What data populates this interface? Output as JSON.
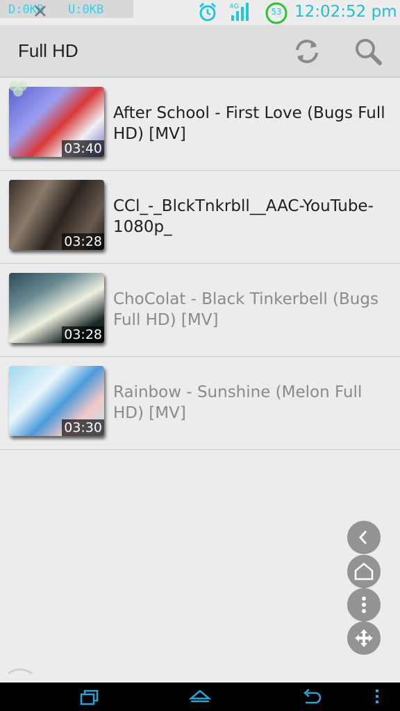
{
  "status_bar": {
    "download_speed": "D:0KB",
    "upload_speed": "U:0KB",
    "battery_level": "53",
    "time": "12:02:52 pm",
    "icons": [
      "close-icon",
      "alarm-icon",
      "signal-icon",
      "battery-icon"
    ]
  },
  "action_bar": {
    "title": "Full HD",
    "icons": [
      "refresh-icon",
      "search-icon"
    ]
  },
  "videos": [
    {
      "title": "After School - First Love (Bugs Full HD) [MV]",
      "duration": "03:40",
      "dimmed": false
    },
    {
      "title": "CCl_-_BlckTnkrbll__AAC-YouTube-1080p_",
      "duration": "03:28",
      "dimmed": false
    },
    {
      "title": "ChoColat - Black Tinkerbell (Bugs Full HD) [MV]",
      "duration": "03:28",
      "dimmed": true
    },
    {
      "title": "Rainbow - Sunshine (Melon Full HD) [MV]",
      "duration": "03:30",
      "dimmed": true
    }
  ],
  "floating_controls": [
    "back-icon",
    "home-icon",
    "more-icon",
    "move-icon"
  ],
  "nav_bar": [
    "recent-apps-icon",
    "home-icon",
    "back-icon",
    "menu-icon"
  ],
  "colors": {
    "accent_cyan": "#22c0cc",
    "battery_green": "#2fc12f",
    "title_text": "#1e1e1e",
    "dimmed_text": "#8a8a8a",
    "nav_bar": "#000000"
  }
}
